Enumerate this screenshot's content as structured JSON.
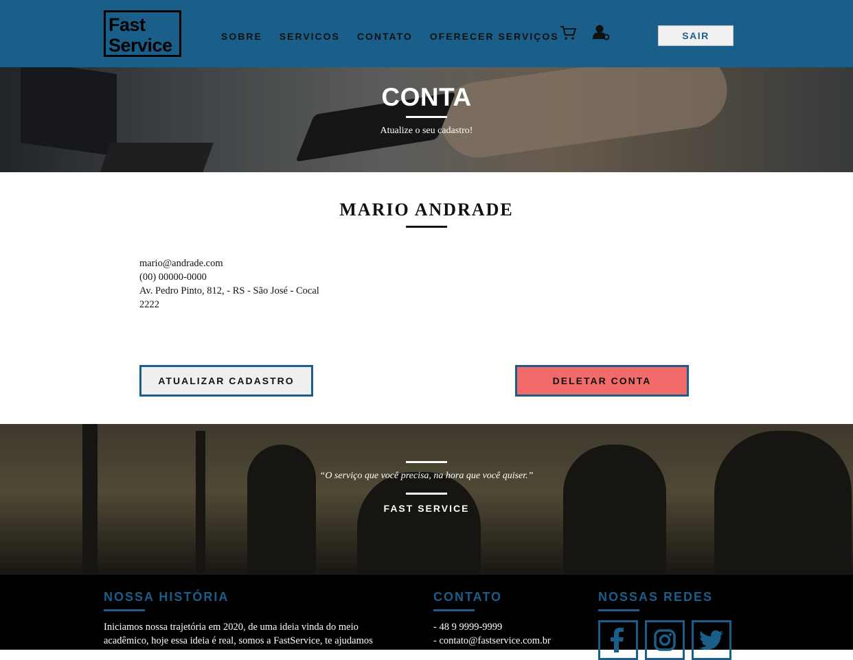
{
  "colors": {
    "brand_blue": "#1a5f8a",
    "delete_red": "#f26a6a",
    "footer_bg": "#000000"
  },
  "header": {
    "logo_line1": "Fast",
    "logo_line2": "Service",
    "menu": [
      {
        "label": "SOBRE"
      },
      {
        "label": "SERVICOS"
      },
      {
        "label": "CONTATO"
      },
      {
        "label": "OFERECER SERVIÇOS"
      }
    ],
    "cart_icon": "cart-icon",
    "user_icon": "user-settings-icon",
    "logout_label": "SAIR"
  },
  "hero": {
    "title": "CONTA",
    "subtitle": "Atualize o seu cadastro!"
  },
  "profile": {
    "name": "MARIO ANDRADE",
    "email": "mario@andrade.com",
    "phone": "(00) 00000-0000",
    "address": "Av. Pedro Pinto, 812, - RS - São José - Cocal",
    "number": "2222",
    "update_label": "ATUALIZAR CADASTRO",
    "delete_label": "DELETAR CONTA"
  },
  "quote": {
    "text": "“O serviço que você precisa, na hora que você quiser.”",
    "brand": "FAST SERVICE"
  },
  "footer": {
    "history_title": "NOSSA HISTÓRIA",
    "history_line1": "Iniciamos nossa trajetória em 2020, de uma ideia vinda do meio",
    "history_line2": "acadêmico, hoje essa ideia é real, somos a FastService, te ajudamos",
    "contact_title": "CONTATO",
    "contact_phone": "- 48 9 9999-9999",
    "contact_email": "- contato@fastservice.com.br",
    "social_title": "NOSSAS REDES",
    "social": [
      "facebook-icon",
      "instagram-icon",
      "twitter-icon"
    ]
  }
}
